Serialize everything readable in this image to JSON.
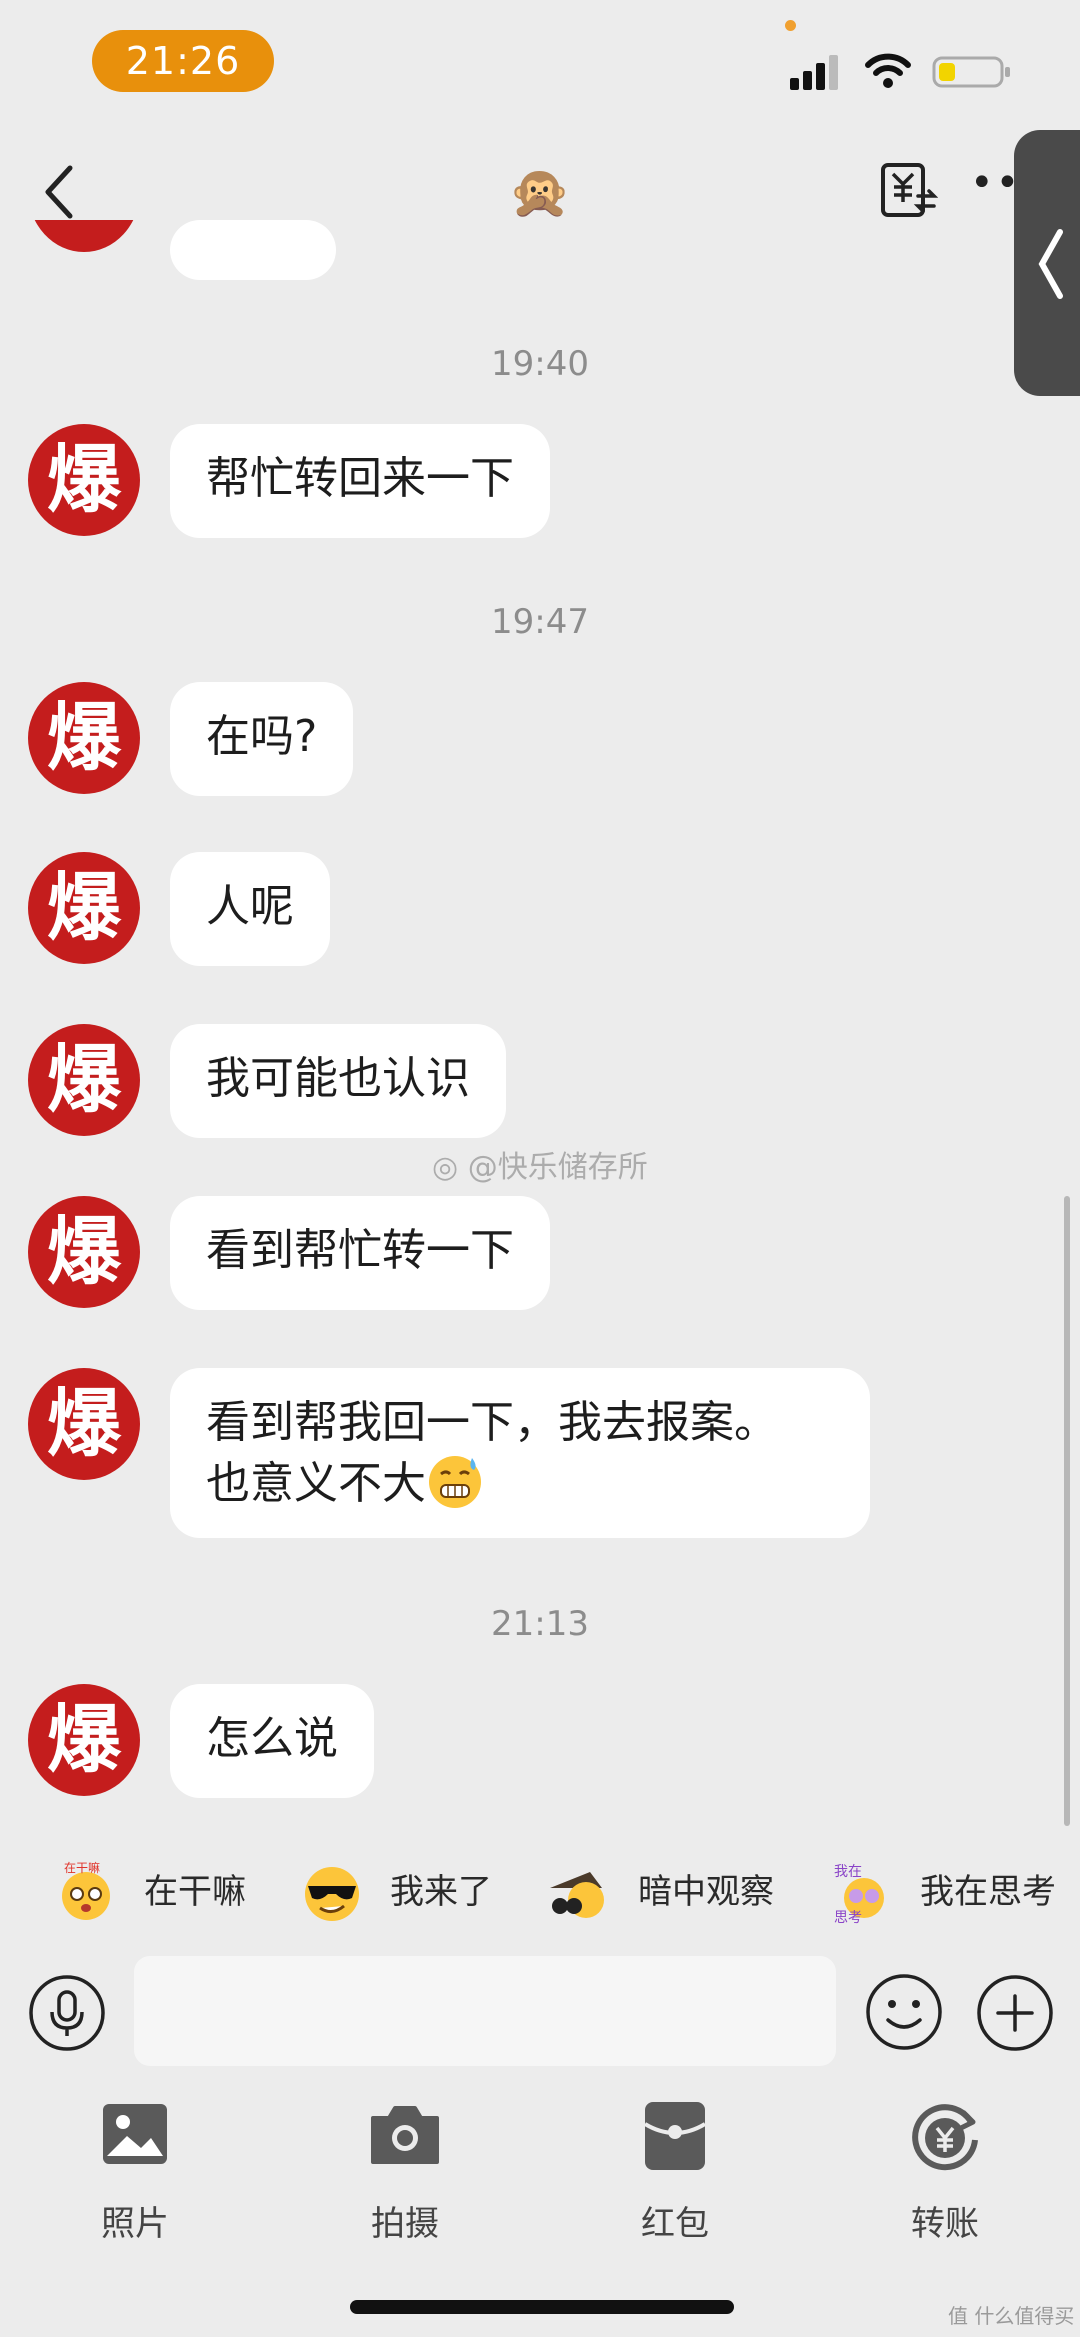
{
  "status_bar": {
    "time": "21:26",
    "time_pill_color": "#e8900c",
    "battery_color": "#f2d400"
  },
  "header": {
    "back_icon": "chevron-left-icon",
    "title": "🙊",
    "transfer_icon": "yuan-transfer-icon",
    "more_label": "•••"
  },
  "contact": {
    "avatar_char": "爆",
    "avatar_color": "#c41d1d"
  },
  "messages": [
    {
      "type": "timestamp",
      "text": "19:40"
    },
    {
      "type": "bubble",
      "text": "帮忙转回来一下"
    },
    {
      "type": "timestamp",
      "text": "19:47"
    },
    {
      "type": "bubble",
      "text": "在吗?"
    },
    {
      "type": "bubble",
      "text": "人呢"
    },
    {
      "type": "bubble",
      "text": "我可能也认识"
    },
    {
      "type": "bubble",
      "text": "看到帮忙转一下"
    },
    {
      "type": "bubble",
      "line1": "看到帮我回一下，我去报案。",
      "line2": "也意义不大",
      "emoji": "grimacing-sweat-icon"
    },
    {
      "type": "timestamp",
      "text": "21:13"
    },
    {
      "type": "bubble",
      "text": "怎么说"
    }
  ],
  "watermark": "@快乐储存所",
  "quick_replies": [
    {
      "label": "在干嘛",
      "icon": "busy-face-icon"
    },
    {
      "label": "我来了",
      "icon": "sunglasses-face-icon"
    },
    {
      "label": "暗中观察",
      "icon": "peeking-face-icon"
    },
    {
      "label": "我在思考",
      "icon": "thinking-face-icon"
    }
  ],
  "input": {
    "placeholder": ""
  },
  "tools": [
    {
      "label": "照片",
      "icon": "photo-icon"
    },
    {
      "label": "拍摄",
      "icon": "camera-icon"
    },
    {
      "label": "红包",
      "icon": "red-packet-icon"
    },
    {
      "label": "转账",
      "icon": "transfer-icon"
    }
  ],
  "corner_watermark": "值 什么值得买"
}
